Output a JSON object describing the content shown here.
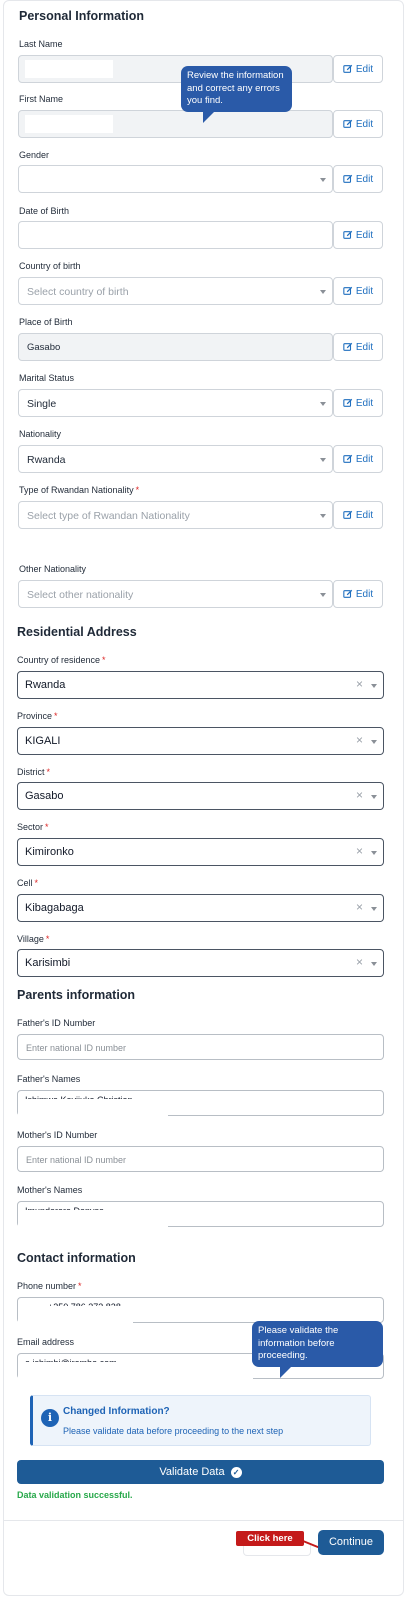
{
  "personal": {
    "title": "Personal Information",
    "last_name_label": "Last Name",
    "first_name_label": "First Name",
    "gender_label": "Gender",
    "dob_label": "Date of Birth",
    "country_birth_label": "Country of birth",
    "country_birth_placeholder": "Select country of birth",
    "place_birth_label": "Place of Birth",
    "place_birth_value": "Gasabo",
    "marital_label": "Marital Status",
    "marital_value": "Single",
    "nationality_label": "Nationality",
    "nationality_value": "Rwanda",
    "type_nat_label": "Type of Rwandan Nationality",
    "type_nat_placeholder": "Select type of Rwandan Nationality",
    "other_nat_label": "Other Nationality",
    "other_nat_placeholder": "Select other nationality",
    "edit_label": "Edit"
  },
  "tooltip_review": "Review the information and correct any errors you find.",
  "residential": {
    "title": "Residential Address",
    "country_label": "Country of residence",
    "country_value": "Rwanda",
    "province_label": "Province",
    "province_value": "KIGALI",
    "district_label": "District",
    "district_value": "Gasabo",
    "sector_label": "Sector",
    "sector_value": "Kimironko",
    "cell_label": "Cell",
    "cell_value": "Kibagabaga",
    "village_label": "Village",
    "village_value": "Karisimbi",
    "required_mark": "*",
    "clear_glyph": "×"
  },
  "parents": {
    "title": "Parents information",
    "father_id_label": "Father's ID Number",
    "father_id_placeholder": "Enter national ID number",
    "father_names_label": "Father's Names",
    "father_names_value": "Ishimwe Kayijuka Christian",
    "mother_id_label": "Mother's ID Number",
    "mother_id_placeholder": "Enter national ID number",
    "mother_names_label": "Mother's Names",
    "mother_names_value": "Imunderere Denyse"
  },
  "contact": {
    "title": "Contact information",
    "phone_label": "Phone number",
    "phone_value": "+250 786 373 828",
    "email_label": "Email address",
    "email_value": "a.ishimbi@irembo.com"
  },
  "tooltip_validate": "Please validate the information before proceeding.",
  "info": {
    "icon": "i",
    "title": "Changed Information?",
    "desc": "Please validate data before proceeding to the next step"
  },
  "validate_label": "Validate Data",
  "success_text": "Data validation successful.",
  "click_here": "Click here",
  "continue_label": "Continue",
  "colors": {
    "primary": "#1e5b96",
    "link": "#1f6fbf",
    "success": "#27a84a",
    "danger": "#c41a1a",
    "tooltip": "#2a5aa8"
  }
}
